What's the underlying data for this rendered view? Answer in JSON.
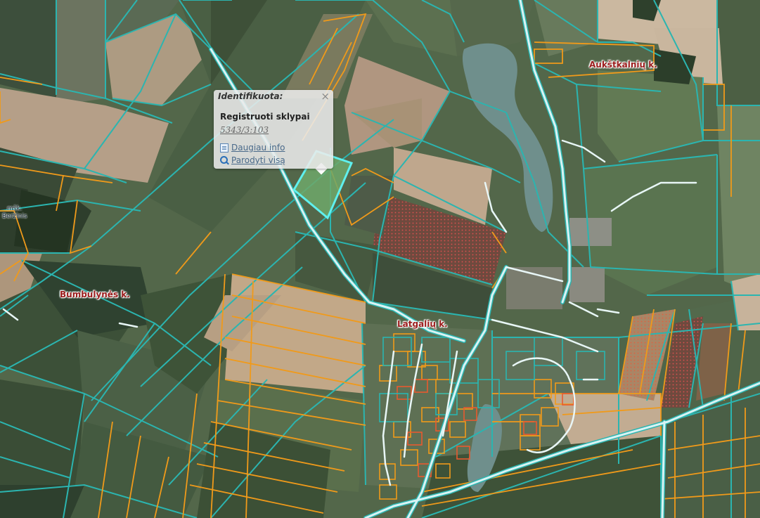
{
  "popup": {
    "title": "Identifikuota:",
    "close_symbol": "×",
    "layer_name": "Registruoti sklypai",
    "parcel_id": "5343/3:103",
    "more_info_label": "Daugiau info",
    "show_all_label": "Parodyti visą",
    "more_info_icon": "document-icon",
    "show_all_icon": "search-icon"
  },
  "places": {
    "aukstkalniu": "Aukštkalnių k.",
    "bumbulynes": "Bumbulynės k.",
    "latgaliu": "Latgalių k.",
    "miskas_line1": "mšk.",
    "miskas_line2": "Beržinis"
  },
  "colors": {
    "parcel_outline": "#2bb5b0",
    "registered_parcel": "#f09a1a",
    "selected_parcel": "#5ff0ee",
    "road": "#d9f3f3",
    "label": "#9b1c1c"
  }
}
